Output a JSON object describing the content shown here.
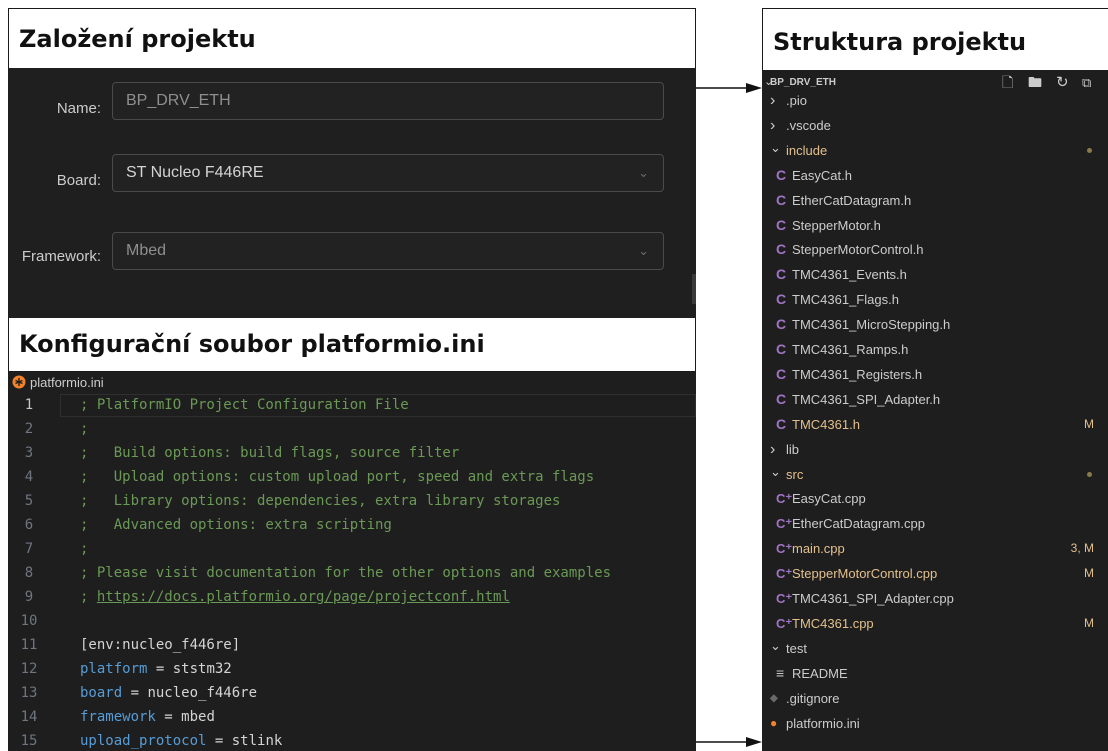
{
  "headers": {
    "setup": "Založení projektu",
    "structure": "Struktura projektu",
    "config": "Konfigurační soubor platformio.ini"
  },
  "setup_form": {
    "name_label": "Name:",
    "name_value": "BP_DRV_ETH",
    "board_label": "Board:",
    "board_value": "ST Nucleo F446RE",
    "framework_label": "Framework:",
    "framework_value": "Mbed"
  },
  "editor": {
    "tab_name": "platformio.ini",
    "lines": [
      {
        "n": "1",
        "text": "; PlatformIO Project Configuration File"
      },
      {
        "n": "2",
        "text": ";"
      },
      {
        "n": "3",
        "text": ";   Build options: build flags, source filter"
      },
      {
        "n": "4",
        "text": ";   Upload options: custom upload port, speed and extra flags"
      },
      {
        "n": "5",
        "text": ";   Library options: dependencies, extra library storages"
      },
      {
        "n": "6",
        "text": ";   Advanced options: extra scripting"
      },
      {
        "n": "7",
        "text": ";"
      },
      {
        "n": "8",
        "text": "; Please visit documentation for the other options and examples"
      },
      {
        "n": "9",
        "prefix": "; ",
        "link": "https://docs.platformio.org/page/projectconf.html"
      },
      {
        "n": "10",
        "text": ""
      },
      {
        "n": "11",
        "text": "[env:nucleo_f446re]"
      },
      {
        "n": "12",
        "key": "platform",
        "eq": " = ",
        "value": "ststm32"
      },
      {
        "n": "13",
        "key": "board",
        "eq": " = ",
        "value": "nucleo_f446re"
      },
      {
        "n": "14",
        "key": "framework",
        "eq": " = ",
        "value": "mbed"
      },
      {
        "n": "15",
        "key": "upload_protocol",
        "eq": " = ",
        "value": "stlink"
      }
    ]
  },
  "explorer": {
    "root": "BP_DRV_ETH",
    "toolbar_icons": [
      "new-file-icon",
      "new-folder-icon",
      "refresh-icon",
      "collapse-all-icon"
    ],
    "items": [
      {
        "label": ".pio",
        "type": "folder-closed",
        "depth": 1
      },
      {
        "label": ".vscode",
        "type": "folder-closed",
        "depth": 1
      },
      {
        "label": "include",
        "type": "folder-open",
        "depth": 1,
        "modified": true,
        "dot": true
      },
      {
        "label": "EasyCat.h",
        "type": "c-header",
        "depth": 2
      },
      {
        "label": "EtherCatDatagram.h",
        "type": "c-header",
        "depth": 2
      },
      {
        "label": "StepperMotor.h",
        "type": "c-header",
        "depth": 2
      },
      {
        "label": "StepperMotorControl.h",
        "type": "c-header",
        "depth": 2
      },
      {
        "label": "TMC4361_Events.h",
        "type": "c-header",
        "depth": 2
      },
      {
        "label": "TMC4361_Flags.h",
        "type": "c-header",
        "depth": 2
      },
      {
        "label": "TMC4361_MicroStepping.h",
        "type": "c-header",
        "depth": 2
      },
      {
        "label": "TMC4361_Ramps.h",
        "type": "c-header",
        "depth": 2
      },
      {
        "label": "TMC4361_Registers.h",
        "type": "c-header",
        "depth": 2
      },
      {
        "label": "TMC4361_SPI_Adapter.h",
        "type": "c-header",
        "depth": 2
      },
      {
        "label": "TMC4361.h",
        "type": "c-header",
        "depth": 2,
        "modified": true,
        "status": "M"
      },
      {
        "label": "lib",
        "type": "folder-closed",
        "depth": 1
      },
      {
        "label": "src",
        "type": "folder-open",
        "depth": 1,
        "modified": true,
        "dot": true
      },
      {
        "label": "EasyCat.cpp",
        "type": "cpp",
        "depth": 2
      },
      {
        "label": "EtherCatDatagram.cpp",
        "type": "cpp",
        "depth": 2
      },
      {
        "label": "main.cpp",
        "type": "cpp",
        "depth": 2,
        "modified": true,
        "status": "3, M"
      },
      {
        "label": "StepperMotorControl.cpp",
        "type": "cpp",
        "depth": 2,
        "modified": true,
        "status": "M"
      },
      {
        "label": "TMC4361_SPI_Adapter.cpp",
        "type": "cpp",
        "depth": 2
      },
      {
        "label": "TMC4361.cpp",
        "type": "cpp",
        "depth": 2,
        "modified": true,
        "status": "M"
      },
      {
        "label": "test",
        "type": "folder-open",
        "depth": 1
      },
      {
        "label": "README",
        "type": "readme",
        "depth": 2
      },
      {
        "label": ".gitignore",
        "type": "gitignore",
        "depth": 1
      },
      {
        "label": "platformio.ini",
        "type": "platformio",
        "depth": 1
      }
    ]
  },
  "colors": {
    "comment": "#6a9955",
    "key": "#569cd6",
    "modified": "#e2c08d",
    "c_icon": "#a074c4",
    "platformio_icon": "#f5822a"
  }
}
